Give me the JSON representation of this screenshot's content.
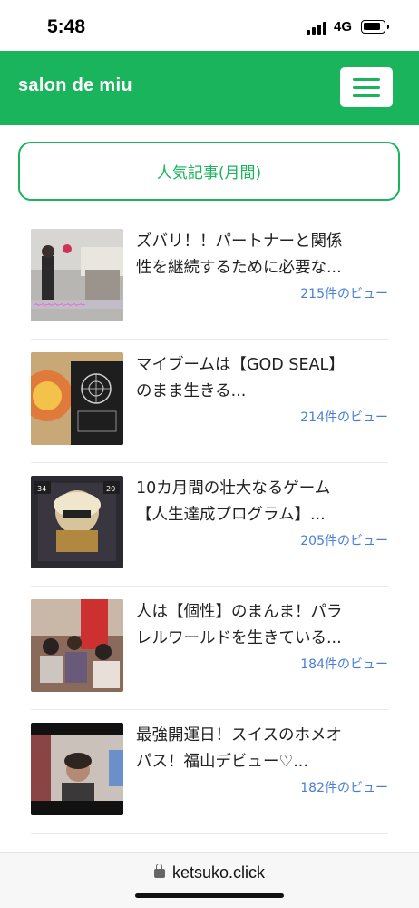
{
  "status_bar": {
    "time": "5:48",
    "network": "4G"
  },
  "header": {
    "site_title": "salon de miu"
  },
  "widget": {
    "title": "人気記事(月間)"
  },
  "posts": [
    {
      "title_line1": "ズバリ！！パートナーと関係",
      "title_line2": "性を継続するために必要な...",
      "views": "215件のビュー"
    },
    {
      "title_line1": "マイブームは【GOD SEAL】",
      "title_line2": "のまま生きる...",
      "views": "214件のビュー"
    },
    {
      "title_line1": "10カ月間の壮大なるゲーム",
      "title_line2": "【人生達成プログラム】...",
      "views": "205件のビュー"
    },
    {
      "title_line1": "人は【個性】のまんま！パラ",
      "title_line2": "レルワールドを生きている...",
      "views": "184件のビュー"
    },
    {
      "title_line1": "最強開運日！スイスのホメオ",
      "title_line2": "パス！福山デビュー♡...",
      "views": "182件のビュー"
    }
  ],
  "browser": {
    "url": "ketsuko.click"
  },
  "colors": {
    "brand_green": "#19b45c",
    "link_blue": "#4a7fd4"
  }
}
